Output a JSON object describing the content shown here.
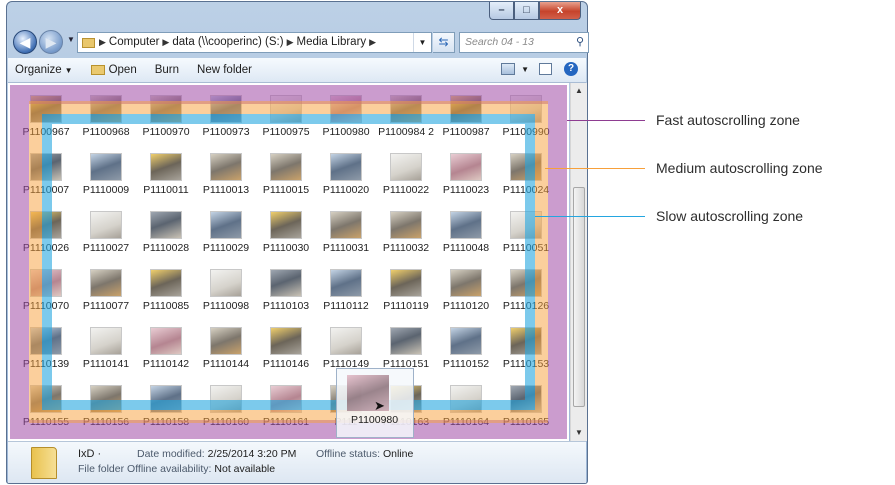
{
  "window": {
    "controls": {
      "minimize": "–",
      "maximize": "□",
      "close": "x"
    }
  },
  "address": {
    "breadcrumb": [
      "Computer",
      "data (\\\\cooperinc) (S:)",
      "Media Library"
    ],
    "search_placeholder": "Search 04 - 13"
  },
  "toolbar": {
    "organize": "Organize",
    "open": "Open",
    "burn": "Burn",
    "new_folder": "New folder"
  },
  "files": [
    "P1100967",
    "P1100968",
    "P1100970",
    "P1100973",
    "P1100975",
    "P1100980",
    "P1100984 2",
    "P1100987",
    "P1100990",
    "P1110007",
    "P1110009",
    "P1110011",
    "P1110013",
    "P1110015",
    "P1110020",
    "P1110022",
    "P1110023",
    "P1110024",
    "P1110026",
    "P1110027",
    "P1110028",
    "P1110029",
    "P1110030",
    "P1110031",
    "P1110032",
    "P1110048",
    "P1110051",
    "P1110070",
    "P1110077",
    "P1110085",
    "P1110098",
    "P1110103",
    "P1110112",
    "P1110119",
    "P1110120",
    "P1110126",
    "P1110139",
    "P1110141",
    "P1110142",
    "P1110144",
    "P1110146",
    "P1110149",
    "P1110151",
    "P1110152",
    "P1110153",
    "P1110155",
    "P1110156",
    "P1110158",
    "P1110160",
    "P1110161",
    "P111",
    "P1110163",
    "P1110164",
    "P1110165"
  ],
  "drag": {
    "name": "P1100980"
  },
  "details": {
    "name": "IxD",
    "date_label": "Date modified:",
    "date_value": "2/25/2014 3:20 PM",
    "offline_label": "Offline status:",
    "offline_value": "Online",
    "type_label": "File folder",
    "availability_label": "Offline availability:",
    "availability_value": "Not available"
  },
  "zones": [
    {
      "label": "Fast autoscrolling zone",
      "color": "#8e3d91"
    },
    {
      "label": "Medium autoscrolling zone",
      "color": "#f7a03a"
    },
    {
      "label": "Slow autoscrolling zone",
      "color": "#24a6e0"
    }
  ]
}
